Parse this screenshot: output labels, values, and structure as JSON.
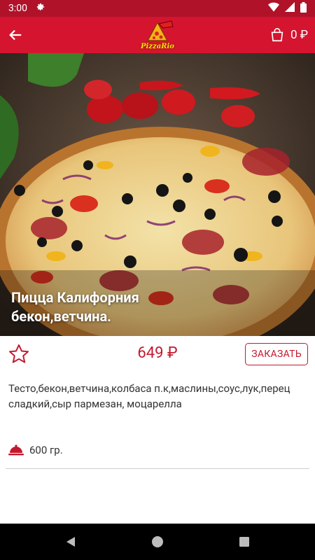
{
  "status_bar": {
    "time": "3:00",
    "icons": [
      "gear-icon",
      "wifi-icon",
      "signal-icon",
      "battery-icon"
    ]
  },
  "app_bar": {
    "logo_text": "PizzaRio",
    "cart_amount": "0 ₽",
    "accent": "#d5142f"
  },
  "product": {
    "title_line1": "Пицца Калифорния",
    "title_line2": "бекон,ветчина.",
    "price": "649 ₽",
    "order_label": "ЗАКАЗАТЬ",
    "ingredients": "Тесто,бекон,ветчина,колбаса п.к,маслины,соус,лук,перец сладкий,сыр пармезан, моцарелла",
    "weight": "600 гр."
  },
  "colors": {
    "price": "#c4182f",
    "status_bar": "#b0122a",
    "app_bar": "#d5142f"
  }
}
